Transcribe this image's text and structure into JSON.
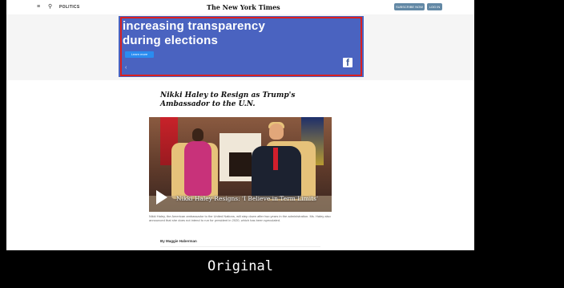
{
  "header": {
    "menu_icon": "≡",
    "search_icon": "⚲",
    "section": "POLITICS",
    "logo": "The New York Times",
    "subscribe_label": "SUBSCRIBE NOW",
    "login_label": "LOG IN"
  },
  "ad": {
    "line1": "increasing transparency",
    "line2": "during elections",
    "cta": "Learn more",
    "brand_icon": "f",
    "back_icon": "‹",
    "highlight_color": "#d92020",
    "background_color": "#4a63c0"
  },
  "article": {
    "headline": "Nikki Haley to Resign as Trump's Ambassador to the U.N.",
    "video_title": "Nikki Haley Resigns: 'I Believe in Term Limits'",
    "caption": "Nikki Haley, the American ambassador to the United Nations, will step down after two years in the administration. Ms. Haley also announced that she does not intend to run for president in 2020, which has been speculated.",
    "byline": "By Maggie Haberman"
  },
  "overlay_label": "Original"
}
